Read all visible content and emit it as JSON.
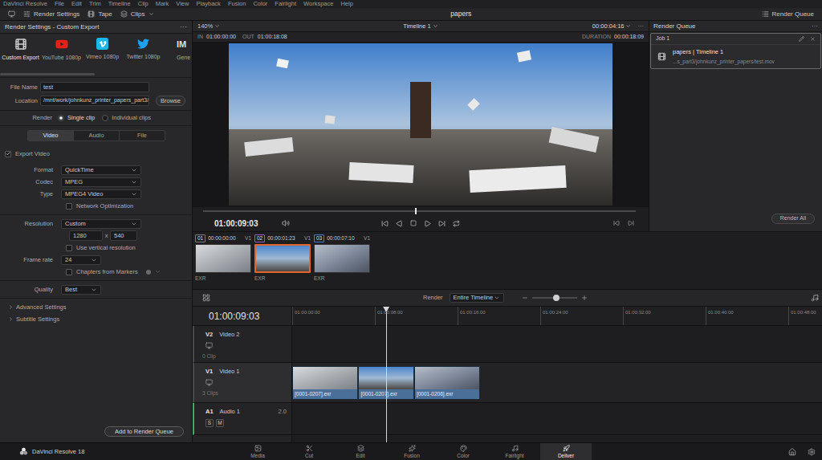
{
  "menu": [
    "DaVinci Resolve",
    "File",
    "Edit",
    "Trim",
    "Timeline",
    "Clip",
    "Mark",
    "View",
    "Playback",
    "Fusion",
    "Color",
    "Fairlight",
    "Workspace",
    "Help"
  ],
  "toolbar": {
    "items": [
      "Render Settings",
      "Tape",
      "Clips"
    ],
    "project": "papers",
    "render_queue": "Render Queue"
  },
  "render_settings": {
    "title": "Render Settings - Custom Export",
    "more": "···",
    "presets": [
      {
        "label": "Custom Export",
        "kind": "custom",
        "selected": true
      },
      {
        "label": "YouTube 1080p",
        "kind": "youtube",
        "selected": false
      },
      {
        "label": "Vimeo 1080p",
        "kind": "vimeo",
        "selected": false
      },
      {
        "label": "Twitter 1080p",
        "kind": "twitter",
        "selected": false
      },
      {
        "label": "Gene",
        "kind": "imf",
        "icon_text": "IM",
        "selected": false
      }
    ],
    "file_name": {
      "label": "File Name",
      "value": "test"
    },
    "location": {
      "label": "Location",
      "value": "/mnt/work/johnkunz_printer_papers_part3/j",
      "button": "Browse"
    },
    "render": {
      "label": "Render",
      "options": [
        {
          "label": "Single clip",
          "selected": true
        },
        {
          "label": "Individual clips",
          "selected": false
        }
      ]
    },
    "tabs": [
      {
        "label": "Video",
        "selected": true
      },
      {
        "label": "Audio",
        "selected": false
      },
      {
        "label": "File",
        "selected": false
      }
    ],
    "export_video": {
      "label": "Export Video",
      "checked": true
    },
    "fields": [
      {
        "kind": "select",
        "label": "Format",
        "value": "QuickTime"
      },
      {
        "kind": "select",
        "label": "Codec",
        "value": "MPEG"
      },
      {
        "kind": "select",
        "label": "Type",
        "value": "MPEG4 Video"
      },
      {
        "kind": "checkbox",
        "label": "Network Optimization",
        "checked": false
      },
      {
        "kind": "divider"
      },
      {
        "kind": "select",
        "label": "Resolution",
        "value": "Custom"
      },
      {
        "kind": "size",
        "width": "1280",
        "separator": "x",
        "height": "540"
      },
      {
        "kind": "checkbox",
        "label": "Use vertical resolution",
        "checked": false
      },
      {
        "kind": "small-select",
        "label": "Frame rate",
        "value": "24"
      },
      {
        "kind": "checkbox-marker",
        "label": "Chapters from Markers",
        "checked": false
      },
      {
        "kind": "divider"
      },
      {
        "kind": "small-select",
        "label": "Quality",
        "value": "Best"
      },
      {
        "kind": "divider"
      }
    ],
    "sections": [
      {
        "label": "Advanced Settings",
        "expanded": false
      },
      {
        "label": "Subtitle Settings",
        "expanded": false
      }
    ],
    "add_button": "Add to Render Queue"
  },
  "viewer": {
    "zoom": "140%",
    "timeline": "Timeline 1",
    "timecode": "00:00:04:16",
    "more": "···",
    "in_label": "IN",
    "in": "01:00:00:00",
    "out_label": "OUT",
    "out": "01:00:18:08",
    "duration_label": "DURATION",
    "duration": "00:00:18:09",
    "current": "01:00:09:03",
    "scrub_level": 0.49
  },
  "clips": [
    {
      "index": "01",
      "timecode": "00:00:00:00",
      "track": "V1",
      "format": "EXR",
      "selected": false,
      "color": "#7a7a7a"
    },
    {
      "index": "02",
      "timecode": "00:00:01:23",
      "track": "V1",
      "format": "EXR",
      "selected": true,
      "color": "#9b59d0"
    },
    {
      "index": "03",
      "timecode": "00:00:07:10",
      "track": "V1",
      "format": "EXR",
      "selected": false,
      "color": "#3b82d6"
    }
  ],
  "timeline": {
    "render_label": "Render",
    "render_value": "Entire Timeline",
    "zoom_level": 0.55,
    "timecode": "01:00:09:03",
    "playhead_seconds": 9.1,
    "ruler": [
      "01:00:00:00",
      "01:00:08:00",
      "01:00:16:00",
      "01:00:24:00",
      "01:00:32:00",
      "01:00:40:00",
      "01:00:48:00"
    ],
    "tracks": [
      {
        "id": "V2",
        "name": "Video 2",
        "count": "0 Clip",
        "kind": "video",
        "selected": false,
        "clips": []
      },
      {
        "id": "V1",
        "name": "Video 1",
        "count": "3 Clips",
        "kind": "video",
        "selected": true,
        "clips": [
          {
            "name": "[0001-0207].exr",
            "length": 6.4
          },
          {
            "name": "[0001-0207].exr",
            "length": 5.4
          },
          {
            "name": "[0001-0206].exr",
            "length": 6.4
          }
        ]
      },
      {
        "id": "A1",
        "name": "Audio 1",
        "kind": "audio",
        "selected": false,
        "channels": "2.0",
        "buttons": [
          {
            "label": "S",
            "on": false
          },
          {
            "label": "M",
            "on": false
          }
        ],
        "clips": []
      }
    ]
  },
  "render_queue": {
    "title": "Render Queue",
    "more": "···",
    "jobs": [
      {
        "name": "Job 1",
        "title": "papers | Timeline 1",
        "path": "...s_part3/johnkunz_printer_papers/test.mov"
      }
    ],
    "render_all": "Render All"
  },
  "pages": {
    "app": "DaVinci Resolve 18",
    "items": [
      {
        "label": "Media",
        "selected": false
      },
      {
        "label": "Cut",
        "selected": false
      },
      {
        "label": "Edit",
        "selected": false
      },
      {
        "label": "Fusion",
        "selected": false
      },
      {
        "label": "Color",
        "selected": false
      },
      {
        "label": "Fairlight",
        "selected": false
      },
      {
        "label": "Deliver",
        "selected": true
      }
    ]
  }
}
